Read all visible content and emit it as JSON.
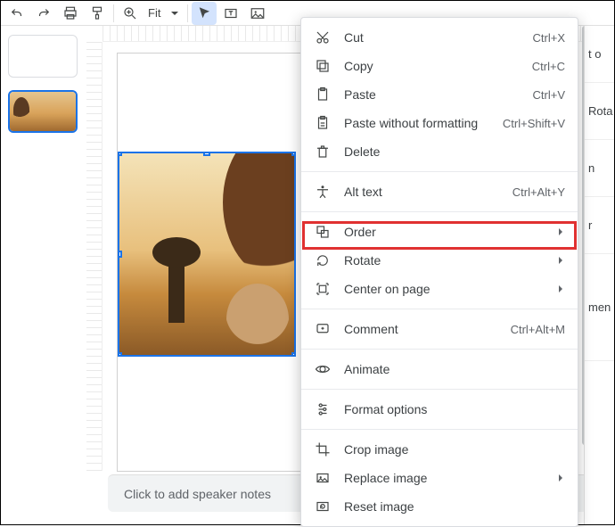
{
  "toolbar": {
    "zoom_label": "Fit"
  },
  "right_fragments": [
    "t o",
    "Rota",
    "n",
    "r",
    "men"
  ],
  "notes_placeholder": "Click to add speaker notes",
  "menu": {
    "cut": {
      "label": "Cut",
      "shortcut": "Ctrl+X"
    },
    "copy": {
      "label": "Copy",
      "shortcut": "Ctrl+C"
    },
    "paste": {
      "label": "Paste",
      "shortcut": "Ctrl+V"
    },
    "paste_nf": {
      "label": "Paste without formatting",
      "shortcut": "Ctrl+Shift+V"
    },
    "delete": {
      "label": "Delete"
    },
    "alt_text": {
      "label": "Alt text",
      "shortcut": "Ctrl+Alt+Y"
    },
    "order": {
      "label": "Order"
    },
    "rotate": {
      "label": "Rotate"
    },
    "center": {
      "label": "Center on page"
    },
    "comment": {
      "label": "Comment",
      "shortcut": "Ctrl+Alt+M"
    },
    "animate": {
      "label": "Animate"
    },
    "format": {
      "label": "Format options"
    },
    "crop": {
      "label": "Crop image"
    },
    "replace": {
      "label": "Replace image"
    },
    "reset": {
      "label": "Reset image"
    }
  }
}
